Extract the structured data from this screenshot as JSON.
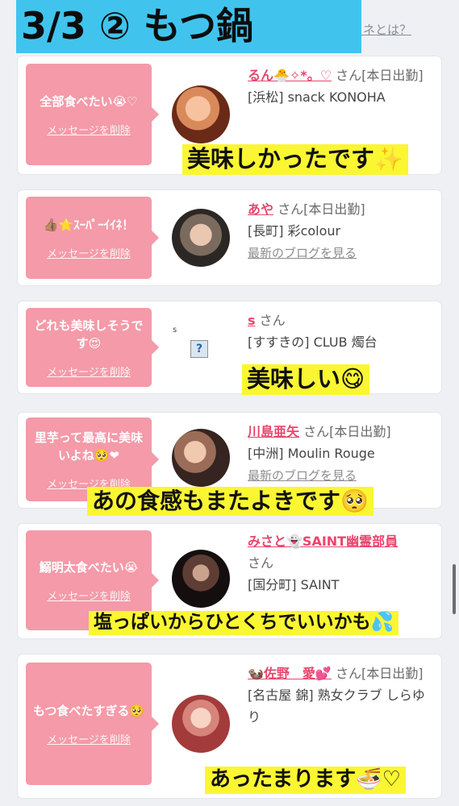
{
  "header": {
    "banner_text": "3/3 ② もつ鍋",
    "top_link": "イイネとは？"
  },
  "cards": [
    {
      "bubble_text": "全部食べたい😭♡",
      "delete_label": "メッセージを削除",
      "name": "るん🐣✧*。♡",
      "honorific": "さん",
      "status": "[本日出勤]",
      "shop": "[浜松] snack KONOHA",
      "caption": "美味しかったです✨"
    },
    {
      "bubble_text": "👍🏽⭐️ｽｰﾊﾟｰｲｲﾈ！",
      "delete_label": "メッセージを削除",
      "name": "あや",
      "honorific": "さん",
      "status": "[本日出勤]",
      "shop": "[長町] 彩colour",
      "blog_link": "最新のブログを見る"
    },
    {
      "bubble_text": "どれも美味しそうです😍",
      "delete_label": "メッセージを削除",
      "name": "s",
      "honorific": "さん",
      "shop": "[すすきの] CLUB 燭台",
      "broken_mark": "s",
      "broken_icon": "?",
      "caption": "美味しい😋"
    },
    {
      "bubble_text": "里芋って最高に美味いよね🥺❤",
      "delete_label": "メッセージを削除",
      "name": "川島亜矢",
      "honorific": "さん",
      "status": "[本日出勤]",
      "shop": "[中洲] Moulin Rouge",
      "blog_link": "最新のブログを見る",
      "caption": "あの食感もまたよきです🥺"
    },
    {
      "bubble_text": "鰯明太食べたい😭",
      "delete_label": "メッセージを削除",
      "name": "みさと👻SAINT幽霊部員",
      "honorific": "さん",
      "shop": "[国分町] SAINT",
      "caption": "塩っぱいからひとくちでいいかも💦"
    },
    {
      "bubble_text": "もつ食べたすぎる🥺",
      "delete_label": "メッセージを削除",
      "name": "🦦佐野　愛💕",
      "honorific": "さん",
      "status": "[本日出勤]",
      "shop": "[名古屋 錦] 熟女クラブ しらゆり",
      "caption": "あったまります🍜♡"
    }
  ],
  "colors": {
    "banner": "#40c4ee",
    "bubble": "#f49aa8",
    "name": "#e9456d",
    "caption": "#fbf632"
  }
}
